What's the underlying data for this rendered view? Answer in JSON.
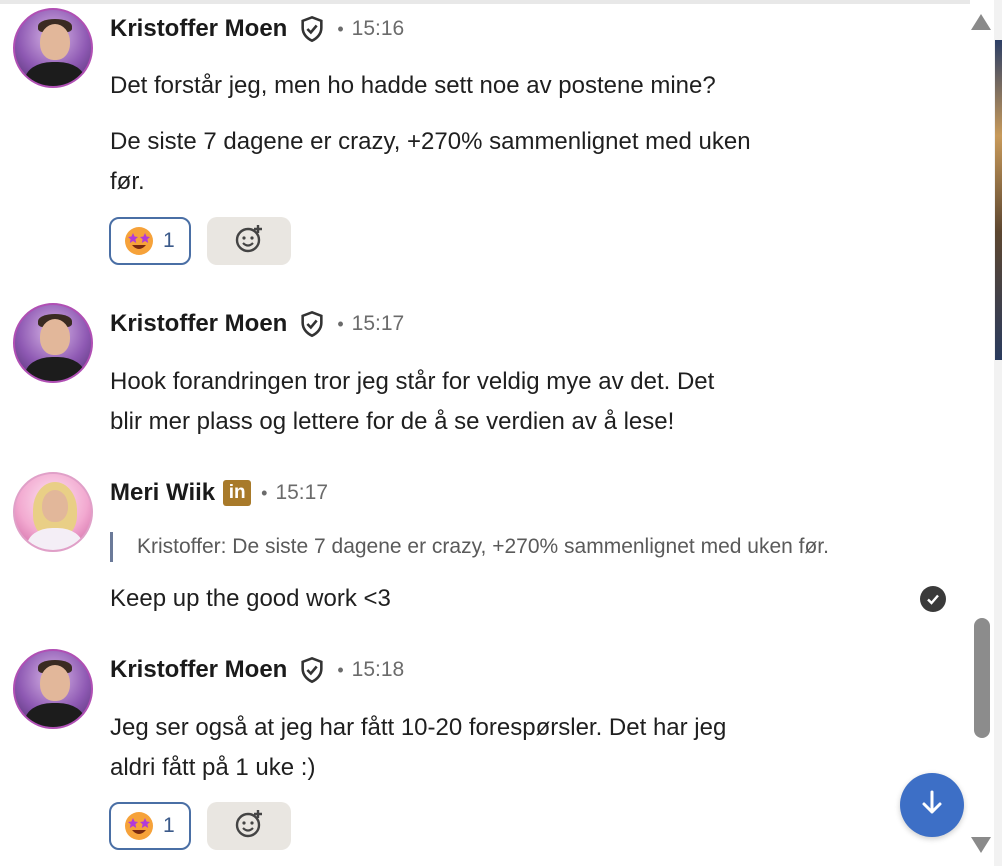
{
  "messages": [
    {
      "sender": "Kristoffer Moen",
      "time": "15:16",
      "separator": "•",
      "paragraphs": [
        "Det forstår jeg, men ho hadde sett noe av postene mine?",
        "De siste 7 dagene er crazy, +270% sammenlignet med uken",
        "før."
      ],
      "reaction": {
        "emoji": "star-struck-emoji",
        "count": "1"
      }
    },
    {
      "sender": "Kristoffer Moen",
      "time": "15:17",
      "separator": "•",
      "lines": [
        "Hook forandringen tror jeg står for veldig mye av det. Det",
        "blir mer plass og lettere for de å se verdien av å lese!"
      ]
    },
    {
      "sender": "Meri Wiik",
      "badge": "in",
      "time": "15:17",
      "separator": "•",
      "quote": "Kristoffer: De siste 7 dagene er crazy, +270% sammenlignet med uken før.",
      "text": "Keep up the good work <3"
    },
    {
      "sender": "Kristoffer Moen",
      "time": "15:18",
      "separator": "•",
      "lines": [
        "Jeg ser også at jeg har fått 10-20 forespørsler. Det har jeg",
        "aldri fått på 1 uke :)"
      ],
      "reaction": {
        "emoji": "star-struck-emoji",
        "count": "1"
      }
    }
  ],
  "icons": {
    "verified": "shield-check-icon",
    "add_reaction": "add-reaction-icon",
    "read_receipt": "check-circle-icon",
    "scroll_to_bottom": "arrow-down-icon"
  },
  "colors": {
    "accent": "#3d6fc6",
    "reaction_border": "#4a6fa5",
    "linkedin_badge": "#a87a2a",
    "avatar_ring": "#b04fb4"
  }
}
